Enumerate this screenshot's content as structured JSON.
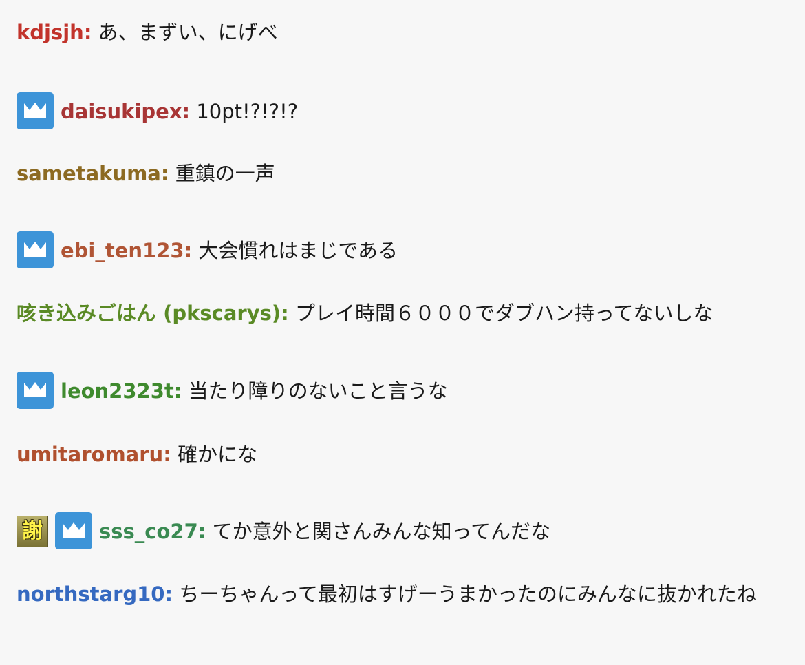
{
  "messages": [
    {
      "badges": [],
      "username": "kdjsjh:",
      "color": "#c2332b",
      "text": "あ、まずい、にげべ"
    },
    {
      "badges": [
        "crown-icon"
      ],
      "username": "daisukipex:",
      "color": "#a83535",
      "text": "10pt!?!?!?"
    },
    {
      "badges": [],
      "username": "sametakuma:",
      "color": "#8c6a22",
      "text": "重鎮の一声"
    },
    {
      "badges": [
        "crown-icon"
      ],
      "username": "ebi_ten123:",
      "color": "#b05535",
      "text": "大会慣れはまじである"
    },
    {
      "badges": [],
      "username": "咳き込みごはん (pkscarys):",
      "color": "#5a8a25",
      "text": "プレイ時間６０００でダブハン持ってないしな"
    },
    {
      "badges": [
        "crown-icon"
      ],
      "username": "leon2323t:",
      "color": "#3f8a2e",
      "text": "当たり障りのないこと言うな"
    },
    {
      "badges": [],
      "username": "umitaromaru:",
      "color": "#b0502e",
      "text": "確かにな"
    },
    {
      "badges": [
        "thanks-icon",
        "crown-icon"
      ],
      "username": "sss_co27:",
      "color": "#3a8a52",
      "text": "てか意外と関さんみんな知ってんだな"
    },
    {
      "badges": [],
      "username": "northstarg10:",
      "color": "#3569c0",
      "text": "ちーちゃんって最初はすげーうまかったのにみんなに抜かれたね"
    }
  ],
  "thanks_badge_glyph": "謝",
  "colors": {
    "background": "#f7f7f7",
    "crown_badge": "#3d94d8"
  }
}
